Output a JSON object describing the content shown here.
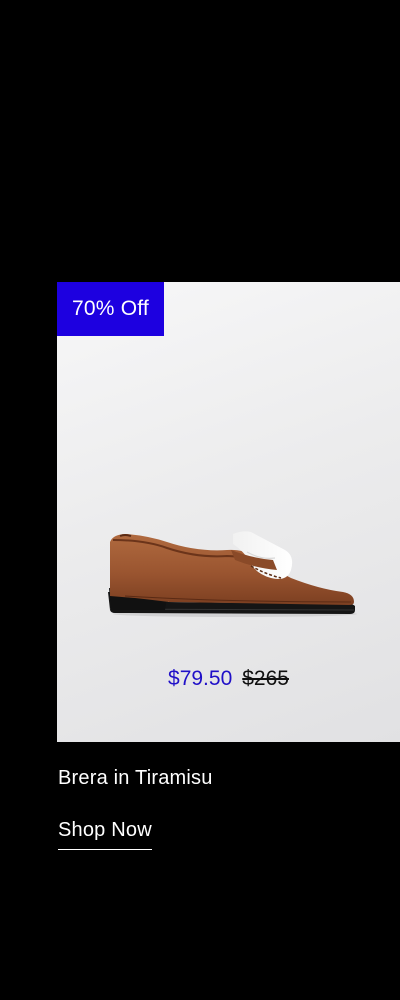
{
  "product": {
    "badge": "70% Off",
    "sale_price": "$79.50",
    "original_price": "$265",
    "name": "Brera in Tiramisu",
    "cta_label": "Shop Now",
    "image_icon": "loafer-shoe-image",
    "colors": {
      "badge_background": "#1d00e0",
      "sale_price": "#2010c8",
      "page_background": "#000000",
      "card_background": "#ececed",
      "leather_brown": "#9b5a33"
    }
  }
}
